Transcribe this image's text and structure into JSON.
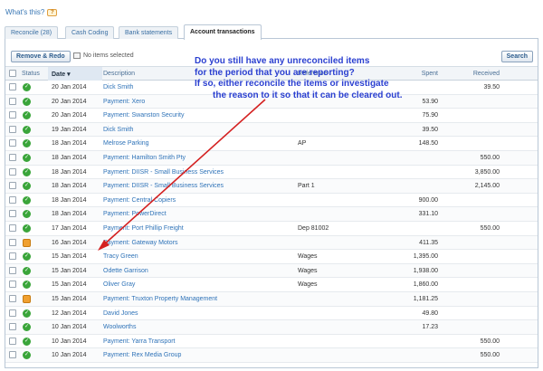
{
  "help": {
    "label": "What's this?"
  },
  "tabs": [
    {
      "label": "Reconcile (28)",
      "active": false
    },
    {
      "label": "Cash Coding",
      "active": false
    },
    {
      "label": "Bank statements",
      "active": false
    },
    {
      "label": "Account transactions",
      "active": true
    }
  ],
  "toolbar": {
    "remove_label": "Remove & Redo",
    "selection_text": "No items selected",
    "search_label": "Search"
  },
  "columns": {
    "status": "Status",
    "date": "Date ▾",
    "description": "Description",
    "reference": "Reference",
    "spent": "Spent",
    "received": "Received"
  },
  "rows": [
    {
      "status": "ok",
      "date": "20 Jan 2014",
      "description": "Dick Smith",
      "reference": "",
      "spent": "",
      "received": "39.50"
    },
    {
      "status": "ok",
      "date": "20 Jan 2014",
      "description": "Payment: Xero",
      "reference": "",
      "spent": "53.90",
      "received": ""
    },
    {
      "status": "ok",
      "date": "20 Jan 2014",
      "description": "Payment: Swanston Security",
      "reference": "",
      "spent": "75.90",
      "received": ""
    },
    {
      "status": "ok",
      "date": "19 Jan 2014",
      "description": "Dick Smith",
      "reference": "",
      "spent": "39.50",
      "received": ""
    },
    {
      "status": "ok",
      "date": "18 Jan 2014",
      "description": "Melrose Parking",
      "reference": "AP",
      "spent": "148.50",
      "received": ""
    },
    {
      "status": "ok",
      "date": "18 Jan 2014",
      "description": "Payment: Hamilton Smith Pty",
      "reference": "",
      "spent": "",
      "received": "550.00"
    },
    {
      "status": "ok",
      "date": "18 Jan 2014",
      "description": "Payment: DIISR - Small Business Services",
      "reference": "",
      "spent": "",
      "received": "3,850.00"
    },
    {
      "status": "ok",
      "date": "18 Jan 2014",
      "description": "Payment: DIISR - Small Business Services",
      "reference": "Part 1",
      "spent": "",
      "received": "2,145.00"
    },
    {
      "status": "ok",
      "date": "18 Jan 2014",
      "description": "Payment: Central Copiers",
      "reference": "",
      "spent": "900.00",
      "received": ""
    },
    {
      "status": "ok",
      "date": "18 Jan 2014",
      "description": "Payment: PowerDirect",
      "reference": "",
      "spent": "331.10",
      "received": ""
    },
    {
      "status": "ok",
      "date": "17 Jan 2014",
      "description": "Payment: Port Phillip Freight",
      "reference": "Dep 81002",
      "spent": "",
      "received": "550.00"
    },
    {
      "status": "warn",
      "date": "16 Jan 2014",
      "description": "Payment: Gateway Motors",
      "reference": "",
      "spent": "411.35",
      "received": ""
    },
    {
      "status": "ok",
      "date": "15 Jan 2014",
      "description": "Tracy Green",
      "reference": "Wages",
      "spent": "1,395.00",
      "received": ""
    },
    {
      "status": "ok",
      "date": "15 Jan 2014",
      "description": "Odette Garrison",
      "reference": "Wages",
      "spent": "1,938.00",
      "received": ""
    },
    {
      "status": "ok",
      "date": "15 Jan 2014",
      "description": "Oliver Gray",
      "reference": "Wages",
      "spent": "1,860.00",
      "received": ""
    },
    {
      "status": "warn",
      "date": "15 Jan 2014",
      "description": "Payment: Truxton Property Management",
      "reference": "",
      "spent": "1,181.25",
      "received": ""
    },
    {
      "status": "ok",
      "date": "12 Jan 2014",
      "description": "David Jones",
      "reference": "",
      "spent": "49.80",
      "received": ""
    },
    {
      "status": "ok",
      "date": "10 Jan 2014",
      "description": "Woolworths",
      "reference": "",
      "spent": "17.23",
      "received": ""
    },
    {
      "status": "ok",
      "date": "10 Jan 2014",
      "description": "Payment: Yarra Transport",
      "reference": "",
      "spent": "",
      "received": "550.00"
    },
    {
      "status": "ok",
      "date": "10 Jan 2014",
      "description": "Payment: Rex Media Group",
      "reference": "",
      "spent": "",
      "received": "550.00"
    }
  ],
  "annotation": {
    "lines": [
      "Do you still have any unreconciled items",
      "for the period that you are reporting?",
      "If so, either reconcile the items or investigate",
      "the reason to it so that it can be cleared out."
    ]
  },
  "colors": {
    "link": "#2f73b8",
    "annotation": "#2a3fd0",
    "arrow": "#d42020",
    "status_ok": "#3aa53a",
    "status_warn": "#f0a030"
  }
}
